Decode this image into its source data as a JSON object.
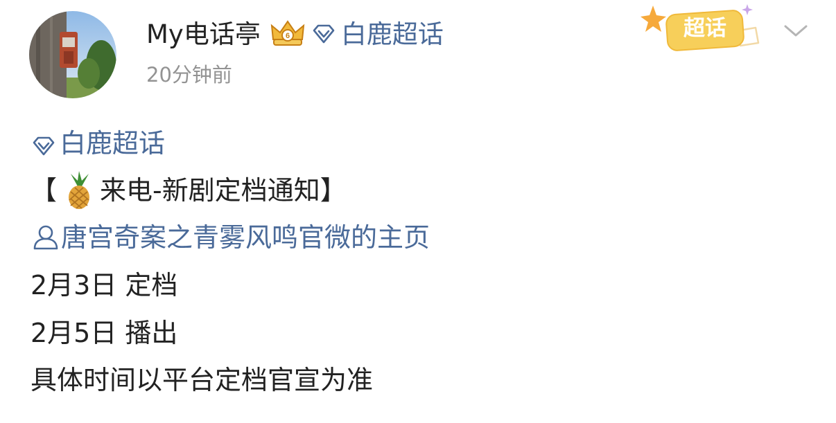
{
  "header": {
    "author_name": "My电话亭",
    "supertopic_label": "白鹿超话",
    "post_time": "20分钟前",
    "badge_label": "超话"
  },
  "post": {
    "supertopic_tag": "白鹿超话",
    "title_open_bracket": "【",
    "title_text": "来电-新剧定档通知",
    "title_close_bracket": "】",
    "account_link": "唐宫奇案之青雾风鸣官微的主页",
    "lines": [
      "2月3日 定档",
      "2月5日 播出",
      "具体时间以平台定档官宣为准"
    ]
  },
  "icons": {
    "avatar": "avatar-phone-booth",
    "crown": "crown-badge-icon",
    "supertopic": "diamond-icon",
    "person": "person-icon",
    "pineapple": "pineapple-icon",
    "chevron": "chevron-down-icon"
  },
  "colors": {
    "link": "#4a6a99",
    "text": "#222222",
    "meta": "#939393",
    "badge": "#f7cf5a"
  }
}
